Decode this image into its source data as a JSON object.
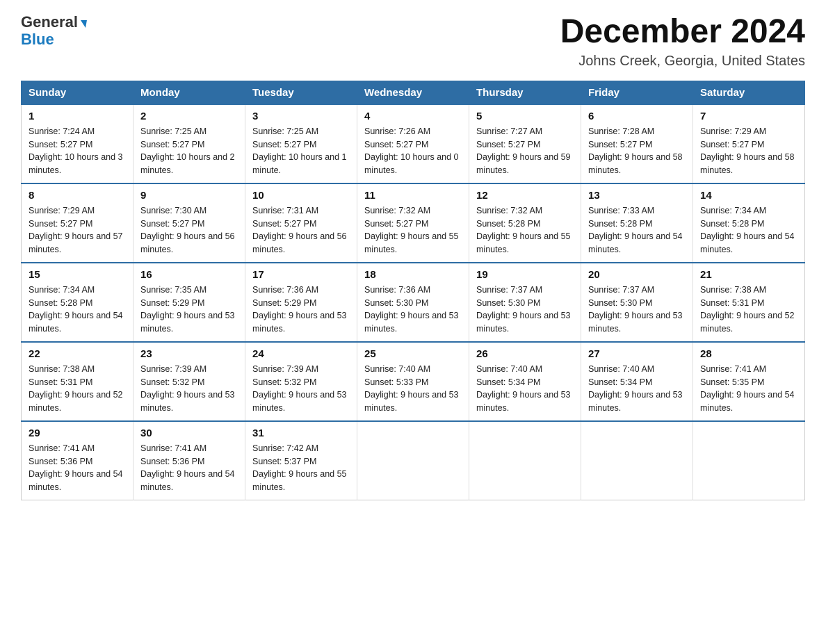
{
  "header": {
    "logo_general": "General",
    "logo_blue": "Blue",
    "title": "December 2024",
    "subtitle": "Johns Creek, Georgia, United States"
  },
  "columns": [
    "Sunday",
    "Monday",
    "Tuesday",
    "Wednesday",
    "Thursday",
    "Friday",
    "Saturday"
  ],
  "weeks": [
    [
      {
        "day": "1",
        "sunrise": "7:24 AM",
        "sunset": "5:27 PM",
        "daylight": "10 hours and 3 minutes."
      },
      {
        "day": "2",
        "sunrise": "7:25 AM",
        "sunset": "5:27 PM",
        "daylight": "10 hours and 2 minutes."
      },
      {
        "day": "3",
        "sunrise": "7:25 AM",
        "sunset": "5:27 PM",
        "daylight": "10 hours and 1 minute."
      },
      {
        "day": "4",
        "sunrise": "7:26 AM",
        "sunset": "5:27 PM",
        "daylight": "10 hours and 0 minutes."
      },
      {
        "day": "5",
        "sunrise": "7:27 AM",
        "sunset": "5:27 PM",
        "daylight": "9 hours and 59 minutes."
      },
      {
        "day": "6",
        "sunrise": "7:28 AM",
        "sunset": "5:27 PM",
        "daylight": "9 hours and 58 minutes."
      },
      {
        "day": "7",
        "sunrise": "7:29 AM",
        "sunset": "5:27 PM",
        "daylight": "9 hours and 58 minutes."
      }
    ],
    [
      {
        "day": "8",
        "sunrise": "7:29 AM",
        "sunset": "5:27 PM",
        "daylight": "9 hours and 57 minutes."
      },
      {
        "day": "9",
        "sunrise": "7:30 AM",
        "sunset": "5:27 PM",
        "daylight": "9 hours and 56 minutes."
      },
      {
        "day": "10",
        "sunrise": "7:31 AM",
        "sunset": "5:27 PM",
        "daylight": "9 hours and 56 minutes."
      },
      {
        "day": "11",
        "sunrise": "7:32 AM",
        "sunset": "5:27 PM",
        "daylight": "9 hours and 55 minutes."
      },
      {
        "day": "12",
        "sunrise": "7:32 AM",
        "sunset": "5:28 PM",
        "daylight": "9 hours and 55 minutes."
      },
      {
        "day": "13",
        "sunrise": "7:33 AM",
        "sunset": "5:28 PM",
        "daylight": "9 hours and 54 minutes."
      },
      {
        "day": "14",
        "sunrise": "7:34 AM",
        "sunset": "5:28 PM",
        "daylight": "9 hours and 54 minutes."
      }
    ],
    [
      {
        "day": "15",
        "sunrise": "7:34 AM",
        "sunset": "5:28 PM",
        "daylight": "9 hours and 54 minutes."
      },
      {
        "day": "16",
        "sunrise": "7:35 AM",
        "sunset": "5:29 PM",
        "daylight": "9 hours and 53 minutes."
      },
      {
        "day": "17",
        "sunrise": "7:36 AM",
        "sunset": "5:29 PM",
        "daylight": "9 hours and 53 minutes."
      },
      {
        "day": "18",
        "sunrise": "7:36 AM",
        "sunset": "5:30 PM",
        "daylight": "9 hours and 53 minutes."
      },
      {
        "day": "19",
        "sunrise": "7:37 AM",
        "sunset": "5:30 PM",
        "daylight": "9 hours and 53 minutes."
      },
      {
        "day": "20",
        "sunrise": "7:37 AM",
        "sunset": "5:30 PM",
        "daylight": "9 hours and 53 minutes."
      },
      {
        "day": "21",
        "sunrise": "7:38 AM",
        "sunset": "5:31 PM",
        "daylight": "9 hours and 52 minutes."
      }
    ],
    [
      {
        "day": "22",
        "sunrise": "7:38 AM",
        "sunset": "5:31 PM",
        "daylight": "9 hours and 52 minutes."
      },
      {
        "day": "23",
        "sunrise": "7:39 AM",
        "sunset": "5:32 PM",
        "daylight": "9 hours and 53 minutes."
      },
      {
        "day": "24",
        "sunrise": "7:39 AM",
        "sunset": "5:32 PM",
        "daylight": "9 hours and 53 minutes."
      },
      {
        "day": "25",
        "sunrise": "7:40 AM",
        "sunset": "5:33 PM",
        "daylight": "9 hours and 53 minutes."
      },
      {
        "day": "26",
        "sunrise": "7:40 AM",
        "sunset": "5:34 PM",
        "daylight": "9 hours and 53 minutes."
      },
      {
        "day": "27",
        "sunrise": "7:40 AM",
        "sunset": "5:34 PM",
        "daylight": "9 hours and 53 minutes."
      },
      {
        "day": "28",
        "sunrise": "7:41 AM",
        "sunset": "5:35 PM",
        "daylight": "9 hours and 54 minutes."
      }
    ],
    [
      {
        "day": "29",
        "sunrise": "7:41 AM",
        "sunset": "5:36 PM",
        "daylight": "9 hours and 54 minutes."
      },
      {
        "day": "30",
        "sunrise": "7:41 AM",
        "sunset": "5:36 PM",
        "daylight": "9 hours and 54 minutes."
      },
      {
        "day": "31",
        "sunrise": "7:42 AM",
        "sunset": "5:37 PM",
        "daylight": "9 hours and 55 minutes."
      },
      null,
      null,
      null,
      null
    ]
  ],
  "labels": {
    "sunrise": "Sunrise:",
    "sunset": "Sunset:",
    "daylight": "Daylight:"
  }
}
